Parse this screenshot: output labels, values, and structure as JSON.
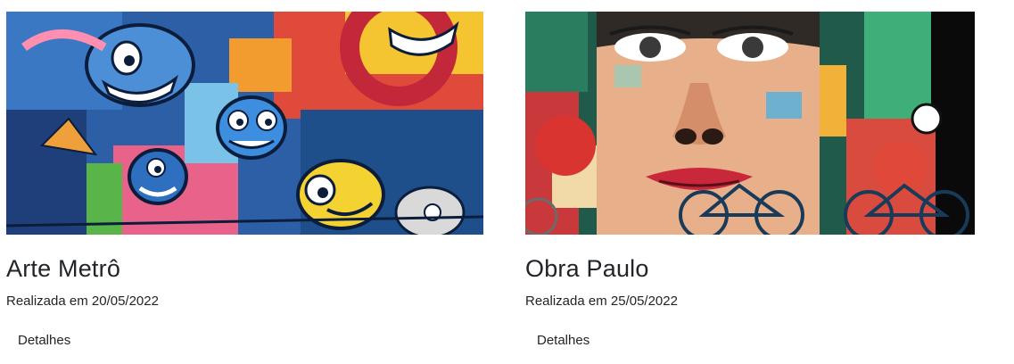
{
  "cards": [
    {
      "image_subject": "colorful graffiti wall with cartoon characters",
      "title": "Arte Metrô",
      "date": "Realizada em 20/05/2022",
      "details_label": "Detalhes"
    },
    {
      "image_subject": "street mural of a woman's face with bicycles in front",
      "title": "Obra Paulo",
      "date": "Realizada em 25/05/2022",
      "details_label": "Detalhes"
    }
  ]
}
